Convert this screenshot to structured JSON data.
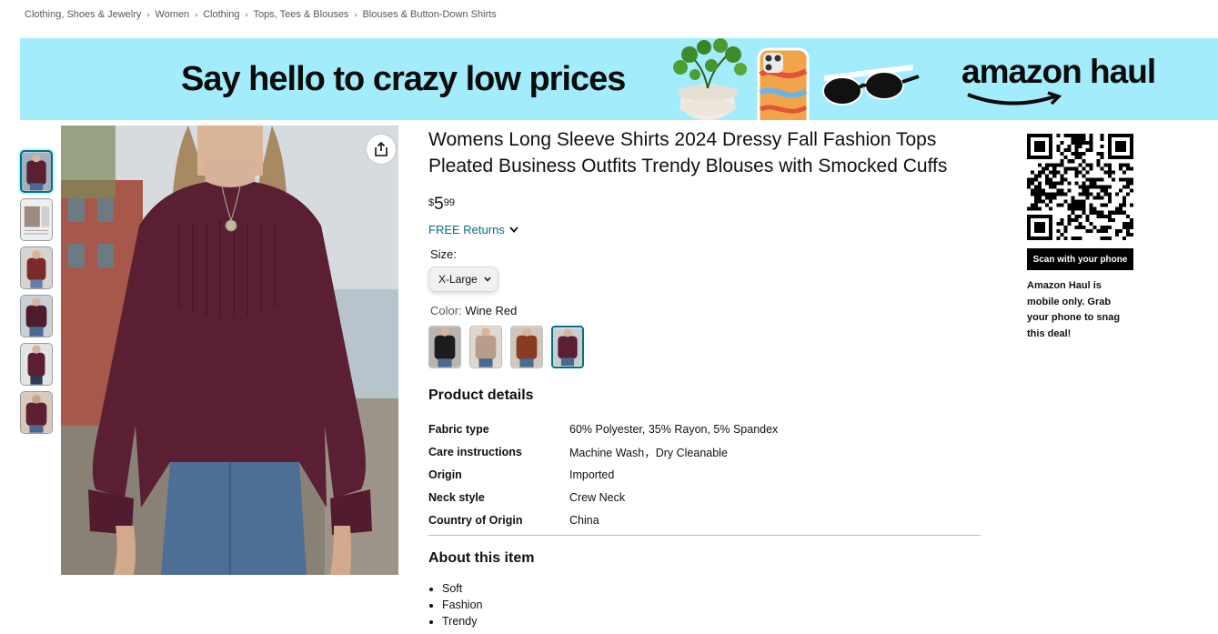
{
  "breadcrumb": [
    "Clothing, Shoes & Jewelry",
    "Women",
    "Clothing",
    "Tops, Tees & Blouses",
    "Blouses & Button-Down Shirts"
  ],
  "banner": {
    "headline": "Say hello to crazy low prices",
    "logo": "amazon haul",
    "background": "#a3ecfb"
  },
  "product": {
    "title": "Womens Long Sleeve Shirts 2024 Dressy Fall Fashion Tops Pleated Business Outfits Trendy Blouses with Smocked Cuffs",
    "price": {
      "symbol": "$",
      "whole": "5",
      "fraction": "99"
    },
    "returns": "FREE Returns",
    "size_label": "Size:",
    "size_value": "X-Large",
    "color_label": "Color:",
    "color_value": "Wine Red",
    "swatch_colors": [
      "#1c1c1e",
      "#b79d8a",
      "#8a3b22",
      "#5a1f33"
    ],
    "selected_swatch": 3,
    "thumbnail_count": 6,
    "share_icon": "share-icon"
  },
  "details": {
    "heading": "Product details",
    "rows": [
      {
        "key": "Fabric type",
        "value": "60% Polyester, 35% Rayon, 5% Spandex"
      },
      {
        "key": "Care instructions",
        "value": "Machine Wash，Dry Cleanable"
      },
      {
        "key": "Origin",
        "value": "Imported"
      },
      {
        "key": "Neck style",
        "value": "Crew Neck"
      },
      {
        "key": "Country of Origin",
        "value": "China"
      }
    ]
  },
  "about": {
    "heading": "About this item",
    "items": [
      "Soft",
      "Fashion",
      "Trendy"
    ]
  },
  "haul": {
    "scan_label": "Scan with your phone",
    "note": "Amazon Haul is mobile only. Grab your phone to snag this deal!"
  },
  "colors": {
    "link": "#007185",
    "shirt": "#5a1f33",
    "text": "#0f1111"
  }
}
